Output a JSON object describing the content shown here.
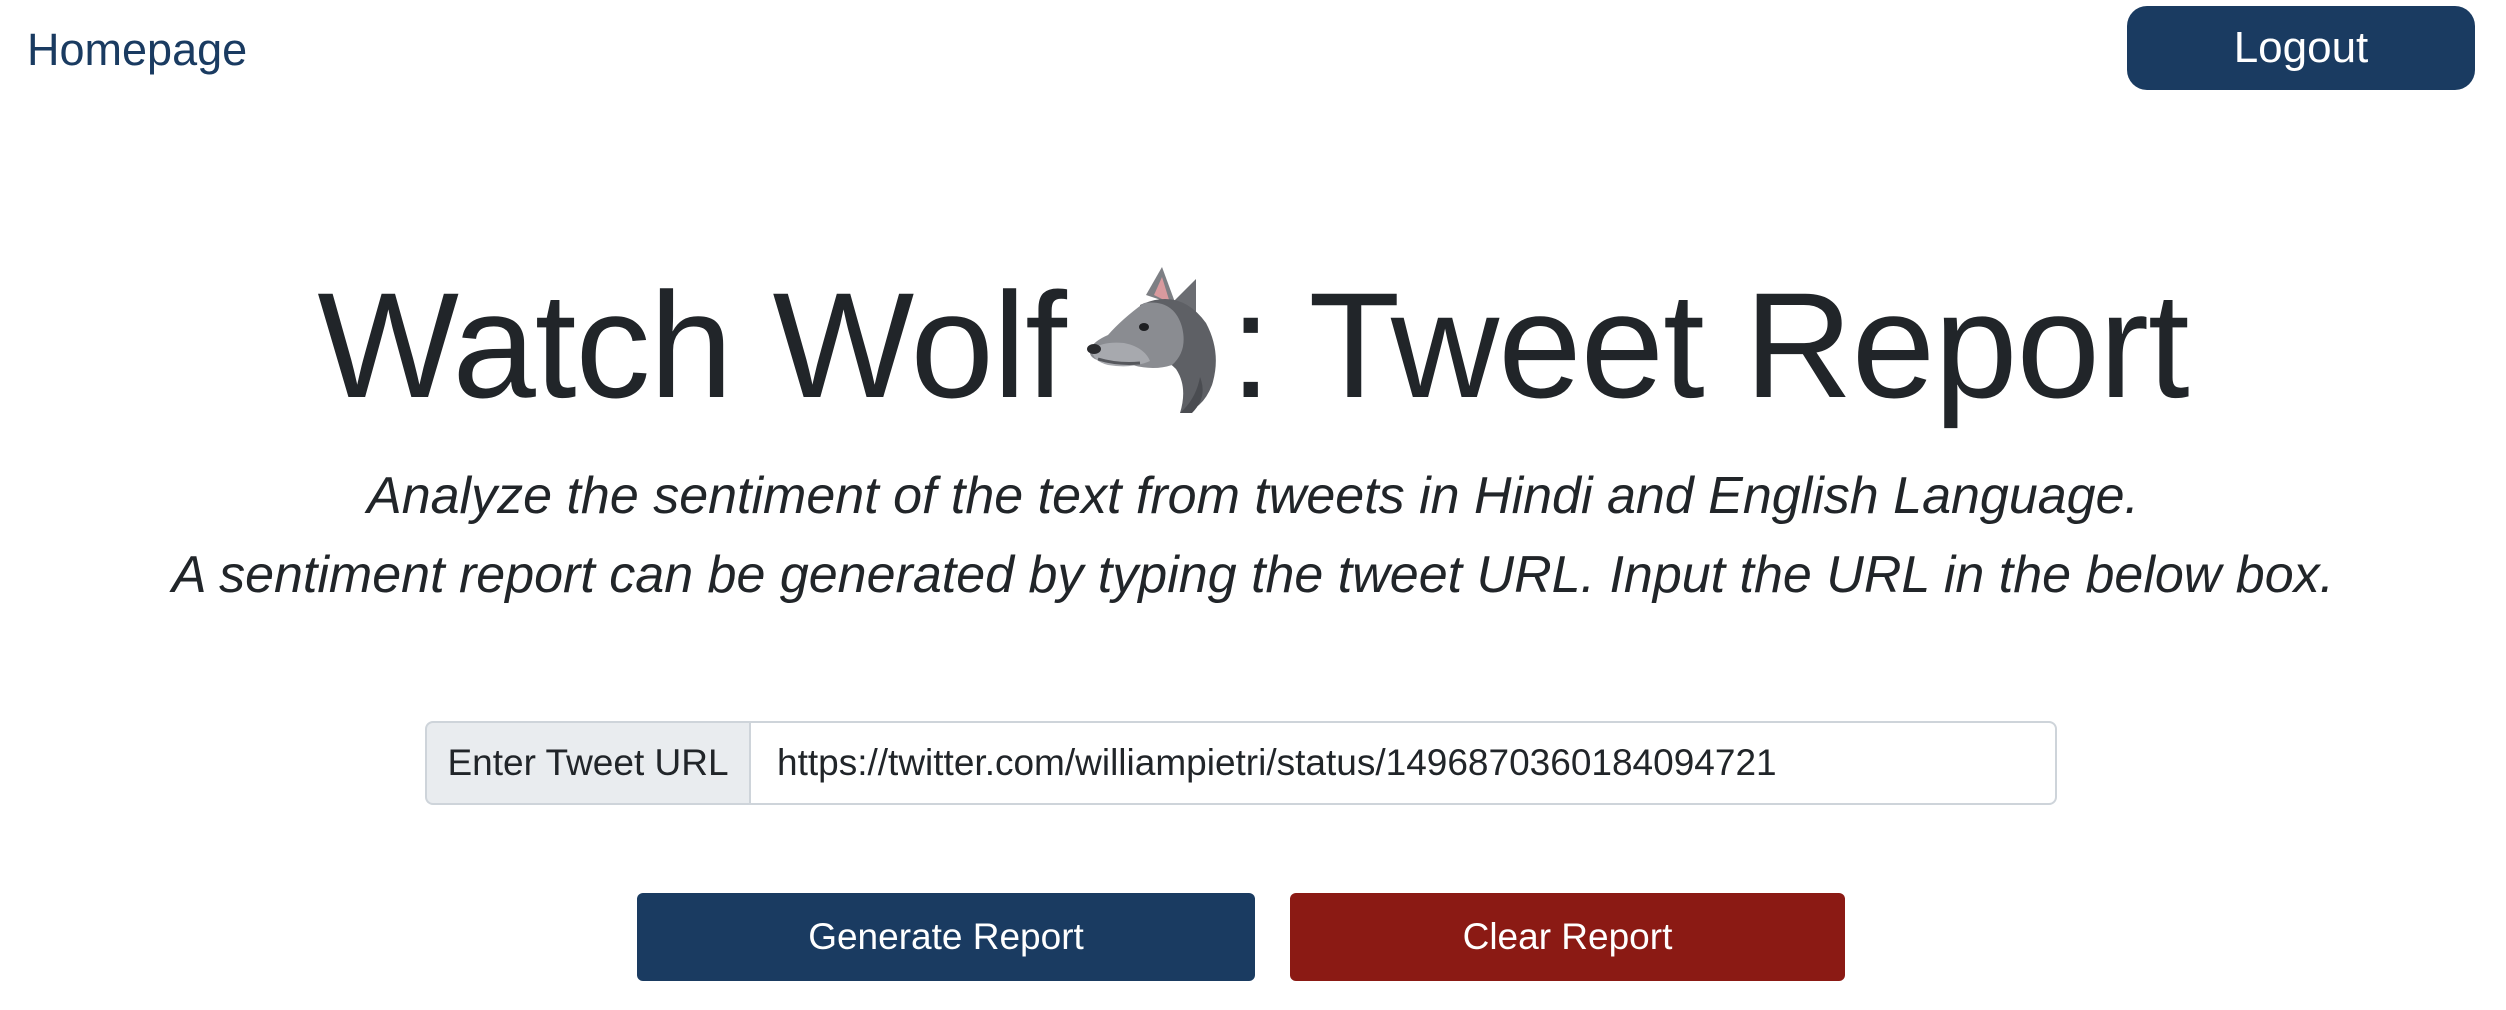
{
  "nav": {
    "homepage_label": "Homepage",
    "logout_label": "Logout"
  },
  "header": {
    "title_before_icon": "Watch Wolf",
    "title_icon": "wolf-icon",
    "title_after_icon": ": Tweet Report",
    "subtitle_line1": "Analyze the sentiment of the text from tweets in Hindi and English Language.",
    "subtitle_line2": "A sentiment report can be generated by typing the tweet URL. Input the URL in the below box."
  },
  "form": {
    "input_label": "Enter Tweet URL",
    "url_value": "https://twitter.com/williampietri/status/1496870360184094721",
    "generate_label": "Generate Report",
    "clear_label": "Clear Report"
  },
  "colors": {
    "primary": "#1a3b61",
    "danger": "#8b1a14",
    "text": "#212529",
    "input_label_bg": "#e9ecef",
    "border": "#ced4da"
  }
}
